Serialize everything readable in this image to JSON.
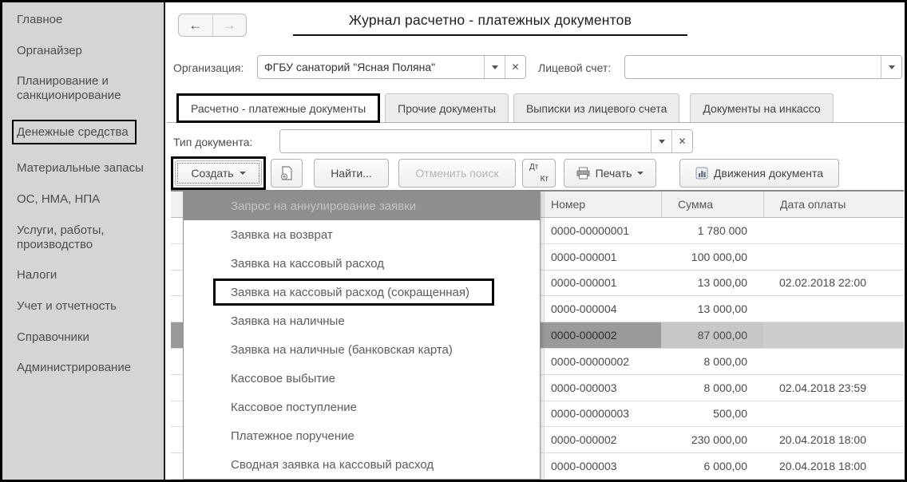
{
  "sidebar": {
    "items": [
      {
        "label": "Главное",
        "boxed": false
      },
      {
        "label": "Органайзер",
        "boxed": false
      },
      {
        "label": "Планирование и санкционирование",
        "boxed": false
      },
      {
        "label": "Денежные средства",
        "boxed": true
      },
      {
        "label": "Материальные запасы",
        "boxed": false
      },
      {
        "label": "ОС, НМА, НПА",
        "boxed": false
      },
      {
        "label": "Услуги, работы, производство",
        "boxed": false
      },
      {
        "label": "Налоги",
        "boxed": false
      },
      {
        "label": "Учет и отчетность",
        "boxed": false
      },
      {
        "label": "Справочники",
        "boxed": false
      },
      {
        "label": "Администрирование",
        "boxed": false
      }
    ]
  },
  "header": {
    "title": "Журнал расчетно - платежных документов"
  },
  "icons": {
    "back": "←",
    "forward": "→",
    "clear": "✕"
  },
  "filters": {
    "org_label": "Организация:",
    "org_value": "ФГБУ санаторий \"Ясная Поляна\"",
    "account_label": "Лицевой счет:",
    "account_value": "",
    "doc_type_label": "Тип документа:",
    "doc_type_value": ""
  },
  "tabs": {
    "items": [
      {
        "label": "Расчетно - платежные документы",
        "active": true
      },
      {
        "label": "Прочие документы",
        "active": false
      },
      {
        "label": "Выписки из лицевого счета",
        "active": false
      },
      {
        "label": "Документы на инкассо",
        "active": false
      }
    ]
  },
  "toolbar": {
    "create_label": "Создать",
    "find_label": "Найти...",
    "cancel_search_label": "Отменить поиск",
    "dt": "Дт",
    "kt": "Кт",
    "print_label": "Печать",
    "movements_label": "Движения документа"
  },
  "dropdown": {
    "items": [
      {
        "label": "Запрос на аннулирование заявки",
        "highlighted": true,
        "boxed": false
      },
      {
        "label": "Заявка на возврат",
        "highlighted": false,
        "boxed": false
      },
      {
        "label": "Заявка на кассовый расход",
        "highlighted": false,
        "boxed": false
      },
      {
        "label": "Заявка на кассовый расход (сокращенная)",
        "highlighted": false,
        "boxed": true
      },
      {
        "label": "Заявка на наличные",
        "highlighted": false,
        "boxed": false
      },
      {
        "label": "Заявка на наличные (банковская карта)",
        "highlighted": false,
        "boxed": false
      },
      {
        "label": "Кассовое выбытие",
        "highlighted": false,
        "boxed": false
      },
      {
        "label": "Кассовое поступление",
        "highlighted": false,
        "boxed": false
      },
      {
        "label": "Платежное поручение",
        "highlighted": false,
        "boxed": false
      },
      {
        "label": "Сводная заявка на кассовый расход",
        "highlighted": false,
        "boxed": false
      }
    ]
  },
  "table": {
    "columns": {
      "number": "Номер",
      "sum": "Сумма",
      "date": "Дата оплаты"
    },
    "rows": [
      {
        "number": "0000-00000001",
        "sum": "1 780 000",
        "date": "",
        "selected": false
      },
      {
        "number": "0000-000001",
        "sum": "100 000,00",
        "date": "",
        "selected": false
      },
      {
        "number": "0000-000001",
        "sum": "13 000,00",
        "date": "02.02.2018 22:00",
        "selected": false
      },
      {
        "number": "0000-000004",
        "sum": "13 000,00",
        "date": "",
        "selected": false
      },
      {
        "number": "0000-000002",
        "sum": "87 000,00",
        "date": "",
        "selected": true
      },
      {
        "number": "0000-00000002",
        "sum": "8 000,00",
        "date": "",
        "selected": false
      },
      {
        "number": "0000-000003",
        "sum": "8 000,00",
        "date": "02.04.2018 23:59",
        "selected": false
      },
      {
        "number": "0000-00000003",
        "sum": "500,00",
        "date": "",
        "selected": false
      },
      {
        "number": "0000-000002",
        "sum": "230 000,00",
        "date": "20.04.2018 18:00",
        "selected": false
      },
      {
        "number": "0000-000003",
        "sum": "6 000,00",
        "date": "20.04.2018 18:00",
        "selected": false
      }
    ]
  },
  "colors": {
    "annotation_box": "#000000",
    "sidebar_bg": "#d5d5d5",
    "menu_highlight": "#8f8f8f",
    "selection_dark": "#9a9a9a",
    "selection_light": "#c7c7c7"
  }
}
